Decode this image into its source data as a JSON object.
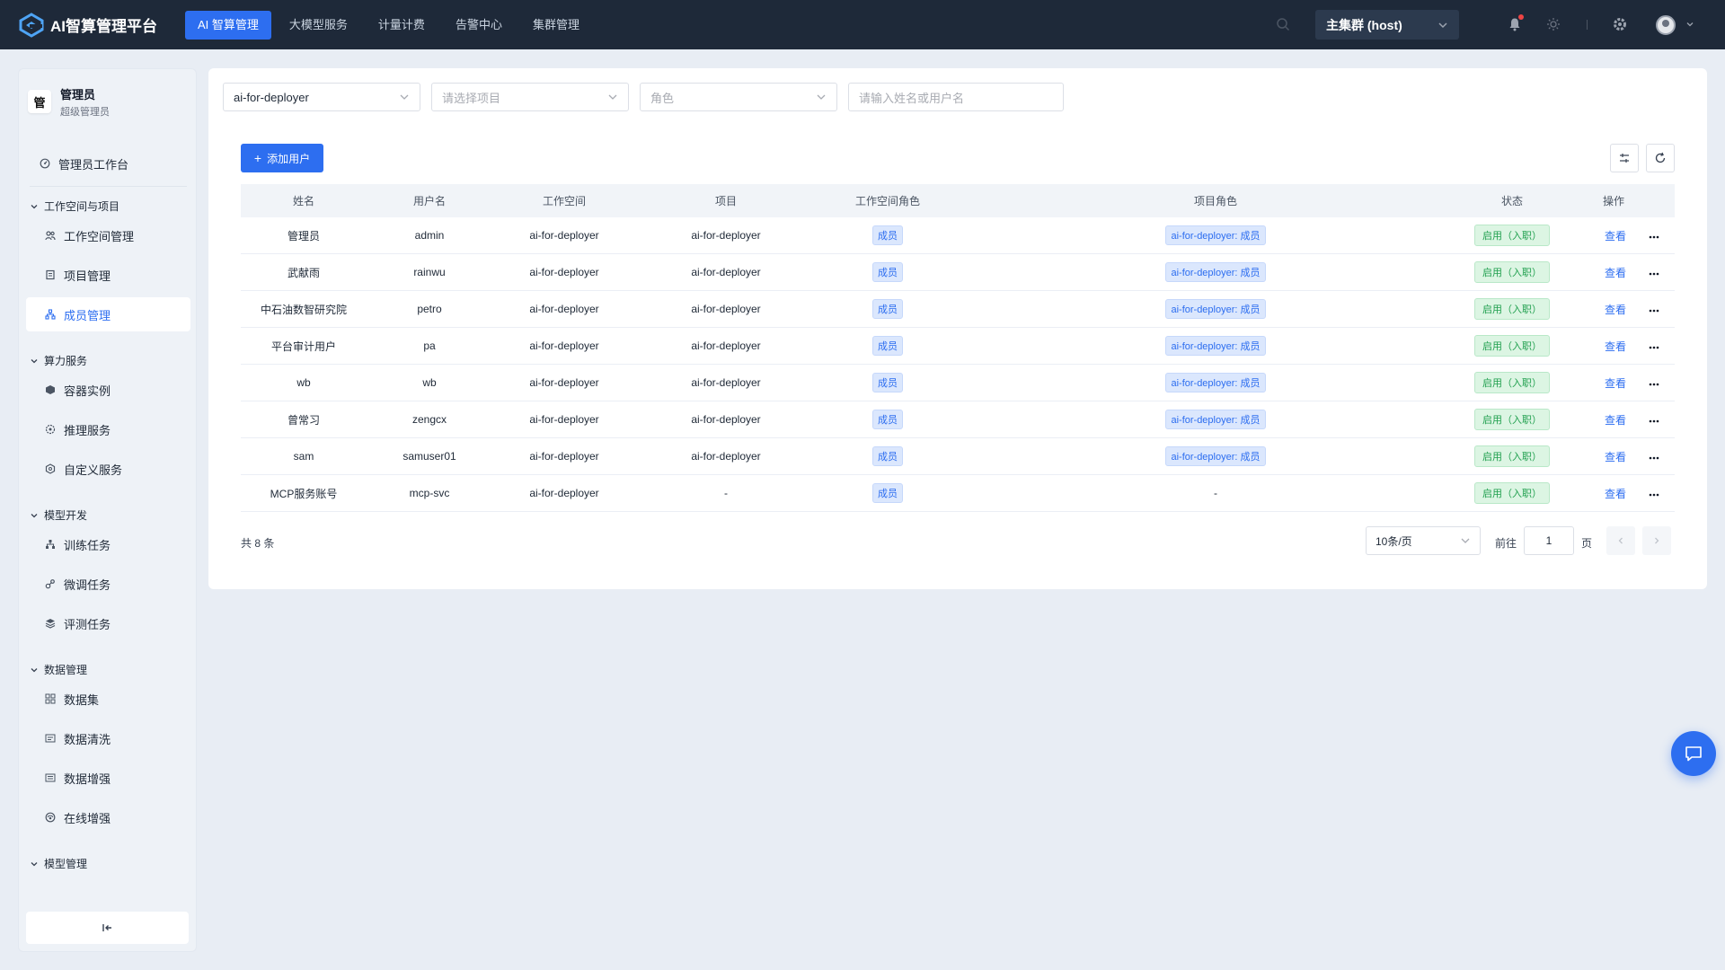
{
  "app": {
    "title": "AI智算管理平台",
    "brand_color": "#2d6ef0"
  },
  "topnav": {
    "items": [
      {
        "label": "AI 智算管理",
        "active": true
      },
      {
        "label": "大模型服务",
        "active": false
      },
      {
        "label": "计量计费",
        "active": false
      },
      {
        "label": "告警中心",
        "active": false
      },
      {
        "label": "集群管理",
        "active": false
      }
    ],
    "cluster": "主集群 (host)"
  },
  "sidebar": {
    "admin_avatar": "管",
    "admin_name": "管理员",
    "admin_role": "超级管理员",
    "workbench": "管理员工作台",
    "groups": [
      {
        "label": "工作空间与项目",
        "items": [
          "工作空间管理",
          "项目管理",
          "成员管理"
        ]
      },
      {
        "label": "算力服务",
        "items": [
          "容器实例",
          "推理服务",
          "自定义服务"
        ]
      },
      {
        "label": "模型开发",
        "items": [
          "训练任务",
          "微调任务",
          "评测任务"
        ]
      },
      {
        "label": "数据管理",
        "items": [
          "数据集",
          "数据清洗",
          "数据增强",
          "在线增强"
        ]
      },
      {
        "label": "模型管理",
        "items": []
      }
    ],
    "active_item": "成员管理"
  },
  "filters": {
    "workspace": "ai-for-deployer",
    "project_placeholder": "请选择项目",
    "role_placeholder": "角色",
    "search_placeholder": "请输入姓名或用户名"
  },
  "toolbar": {
    "add_user": "添加用户"
  },
  "table": {
    "headers": [
      "姓名",
      "用户名",
      "工作空间",
      "项目",
      "工作空间角色",
      "项目角色",
      "状态",
      "操作"
    ],
    "rows": [
      {
        "name": "管理员",
        "username": "admin",
        "workspace": "ai-for-deployer",
        "project": "ai-for-deployer",
        "ws_role": "成员",
        "project_role": "ai-for-deployer: 成员",
        "status": "启用（入职）",
        "action": "查看"
      },
      {
        "name": "武献雨",
        "username": "rainwu",
        "workspace": "ai-for-deployer",
        "project": "ai-for-deployer",
        "ws_role": "成员",
        "project_role": "ai-for-deployer: 成员",
        "status": "启用（入职）",
        "action": "查看"
      },
      {
        "name": "中石油数智研究院",
        "username": "petro",
        "workspace": "ai-for-deployer",
        "project": "ai-for-deployer",
        "ws_role": "成员",
        "project_role": "ai-for-deployer: 成员",
        "status": "启用（入职）",
        "action": "查看"
      },
      {
        "name": "平台审计用户",
        "username": "pa",
        "workspace": "ai-for-deployer",
        "project": "ai-for-deployer",
        "ws_role": "成员",
        "project_role": "ai-for-deployer: 成员",
        "status": "启用（入职）",
        "action": "查看"
      },
      {
        "name": "wb",
        "username": "wb",
        "workspace": "ai-for-deployer",
        "project": "ai-for-deployer",
        "ws_role": "成员",
        "project_role": "ai-for-deployer: 成员",
        "status": "启用（入职）",
        "action": "查看"
      },
      {
        "name": "曾常习",
        "username": "zengcx",
        "workspace": "ai-for-deployer",
        "project": "ai-for-deployer",
        "ws_role": "成员",
        "project_role": "ai-for-deployer: 成员",
        "status": "启用（入职）",
        "action": "查看"
      },
      {
        "name": "sam",
        "username": "samuser01",
        "workspace": "ai-for-deployer",
        "project": "ai-for-deployer",
        "ws_role": "成员",
        "project_role": "ai-for-deployer: 成员",
        "status": "启用（入职）",
        "action": "查看"
      },
      {
        "name": "MCP服务账号",
        "username": "mcp-svc",
        "workspace": "ai-for-deployer",
        "project": "-",
        "ws_role": "成员",
        "project_role": "-",
        "status": "启用（入职）",
        "action": "查看"
      }
    ]
  },
  "pagination": {
    "total": "共 8 条",
    "page_size": "10条/页",
    "goto_label": "前往",
    "current_page": "1",
    "page_suffix": "页"
  }
}
